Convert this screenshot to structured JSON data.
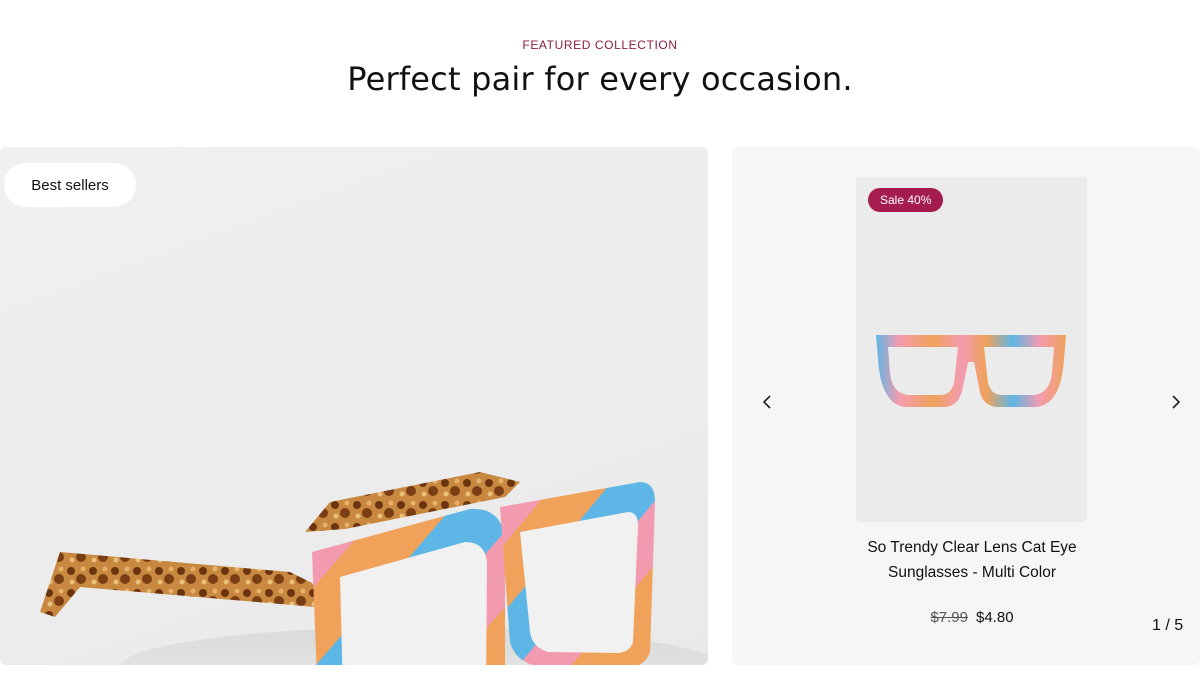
{
  "section": {
    "eyebrow": "FEATURED COLLECTION",
    "headline": "Perfect pair for every occasion."
  },
  "hero": {
    "badge_label": "Best sellers",
    "image_icon": "glasses-product-photo"
  },
  "carousel": {
    "prev_icon": "chevron-left-icon",
    "next_icon": "chevron-right-icon",
    "pager": "1 / 5",
    "product": {
      "sale_badge": "Sale 40%",
      "title": "So Trendy Clear Lens Cat Eye Sunglasses - Multi Color",
      "price_old": "$7.99",
      "price_new": "$4.80"
    }
  },
  "colors": {
    "accent": "#8b1d43",
    "sale_badge": "#a51d4f",
    "tortoise": "#b8743a",
    "pink": "#f29bb0",
    "blue": "#5eb6e6",
    "orange": "#f0a25a"
  }
}
